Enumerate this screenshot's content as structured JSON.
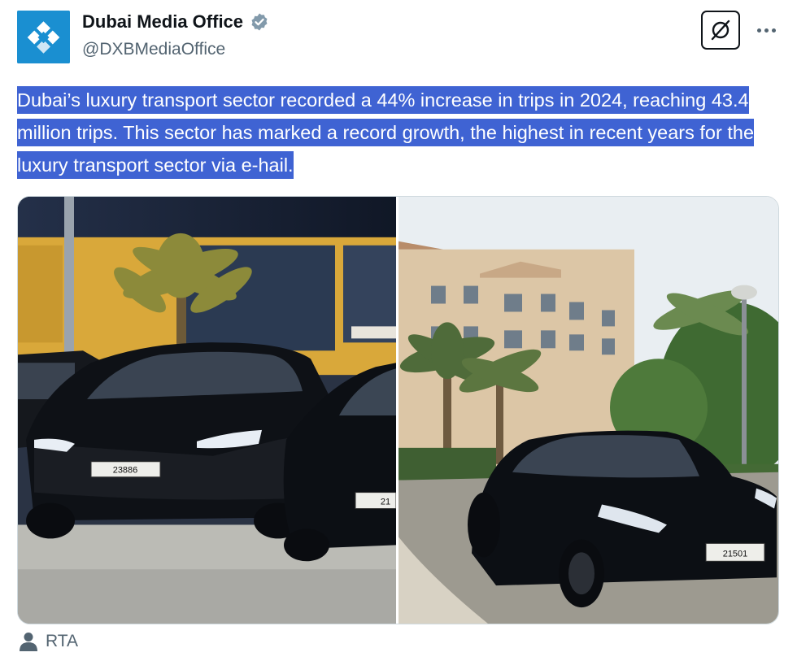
{
  "author": {
    "name": "Dubai Media Office",
    "handle": "@DXBMediaOffice",
    "verified": true,
    "avatar_icon": "dubai-media-office-logo",
    "brand_color": "#1a8fd1"
  },
  "actions": {
    "grok_icon": "grok-icon",
    "more_icon": "more-icon"
  },
  "tweet": {
    "text": "Dubai’s luxury transport sector recorded a 44% increase in trips in 2024, reaching 43.4 million trips. This sector has marked a record growth, the highest in recent years for the luxury transport sector via e-hail.",
    "highlight_color": "#3f63d3"
  },
  "media": {
    "left_photo": {
      "plate_main": "23886",
      "plate_side": "21"
    },
    "right_photo": {
      "plate": "21501"
    }
  },
  "credit": {
    "icon": "person-icon",
    "label": "RTA"
  }
}
